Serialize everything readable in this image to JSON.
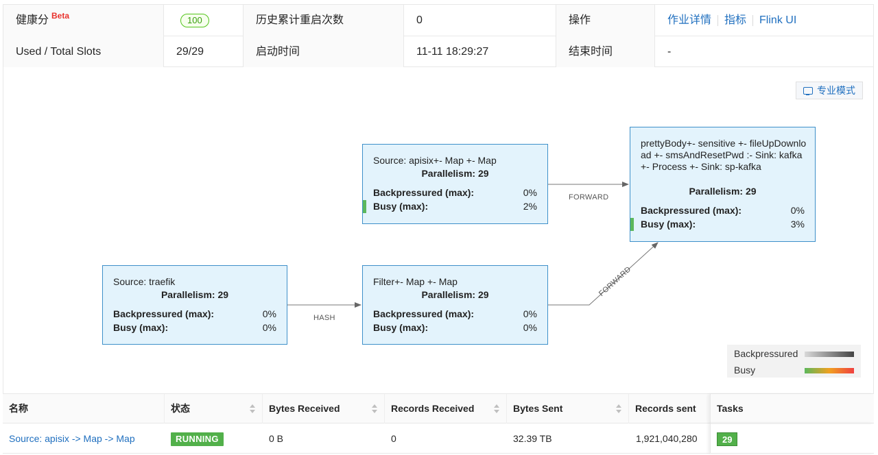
{
  "info": {
    "health_label": "健康分",
    "beta": "Beta",
    "health_score": "100",
    "restart_label": "历史累计重启次数",
    "restart_value": "0",
    "ops_label": "操作",
    "ops_links": [
      "作业详情",
      "指标",
      "Flink UI"
    ],
    "slots_label": "Used / Total Slots",
    "slots_value": "29/29",
    "start_label": "启动时间",
    "start_value": "11-11 18:29:27",
    "end_label": "结束时间",
    "end_value": "-"
  },
  "graph": {
    "expert_mode": "专业模式",
    "nodes": [
      {
        "name": "Source: traefik",
        "parallelism": "Parallelism: 29",
        "bp_label": "Backpressured (max):",
        "bp": "0%",
        "busy_label": "Busy (max):",
        "busy": "0%"
      },
      {
        "name": "Filter+- Map +- Map",
        "parallelism": "Parallelism: 29",
        "bp_label": "Backpressured (max):",
        "bp": "0%",
        "busy_label": "Busy (max):",
        "busy": "0%"
      },
      {
        "name": "Source: apisix+- Map +- Map",
        "parallelism": "Parallelism: 29",
        "bp_label": "Backpressured (max):",
        "bp": "0%",
        "busy_label": "Busy (max):",
        "busy": "2%"
      },
      {
        "name": "prettyBody+- sensitive +- fileUpDownload +- smsAndResetPwd :- Sink: kafka +- Process +- Sink: sp-kafka",
        "parallelism": "Parallelism: 29",
        "bp_label": "Backpressured (max):",
        "bp": "0%",
        "busy_label": "Busy (max):",
        "busy": "3%"
      }
    ],
    "edges": [
      "HASH",
      "FORWARD",
      "FORWARD"
    ],
    "legend": {
      "backpressured": "Backpressured",
      "busy": "Busy"
    }
  },
  "table": {
    "headers": [
      "名称",
      "状态",
      "Bytes Received",
      "Records Received",
      "Bytes Sent",
      "Records sent",
      "Tasks"
    ],
    "rows": [
      {
        "name": "Source: apisix -> Map -> Map",
        "status": "RUNNING",
        "bytes_received": "0 B",
        "records_received": "0",
        "bytes_sent": "32.39 TB",
        "records_sent": "1,921,040,280",
        "tasks": "29"
      }
    ]
  },
  "colors": {
    "node_fill": "#e3f3fc",
    "node_border": "#3d8fc9",
    "link": "#1f6fbf",
    "running": "#52b04a"
  }
}
